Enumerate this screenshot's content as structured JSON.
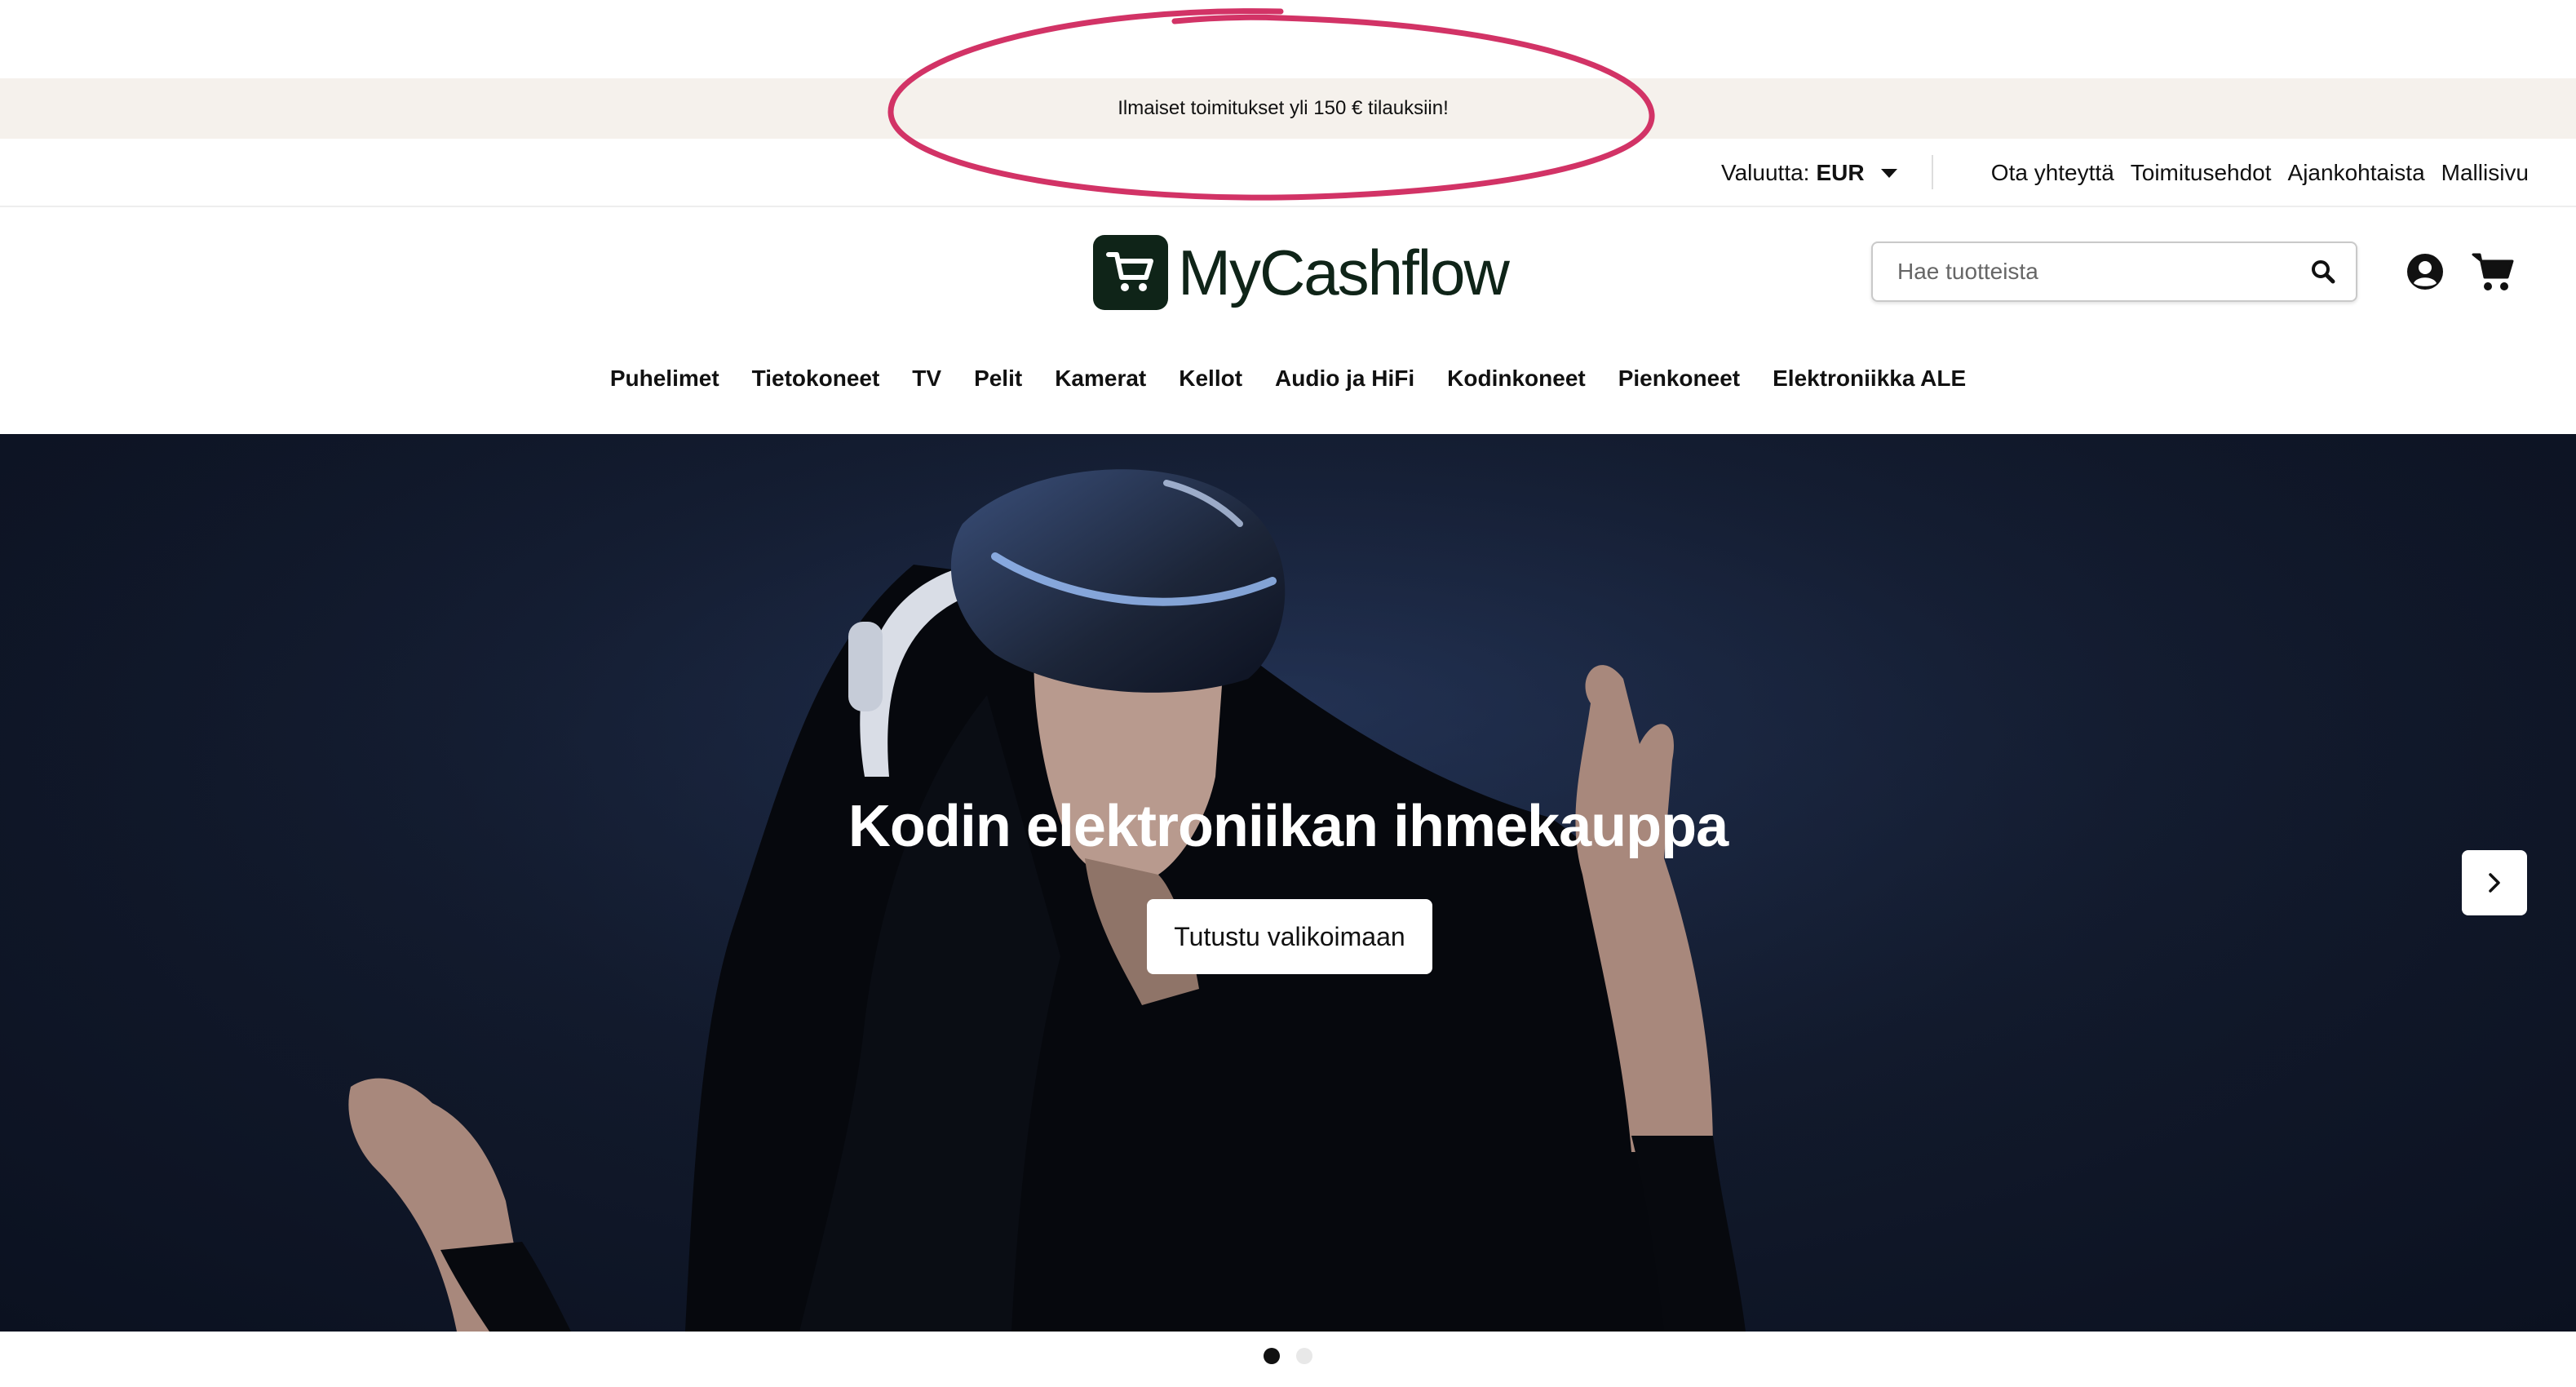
{
  "promo": {
    "text": "Ilmaiset toimitukset yli 150 € tilauksiin!"
  },
  "utility": {
    "currency_label": "Valuutta:",
    "currency_value": "EUR",
    "links": [
      "Ota yhteyttä",
      "Toimitusehdot",
      "Ajankohtaista",
      "Mallisivu"
    ]
  },
  "header": {
    "logo_text": "MyCashflow",
    "search_placeholder": "Hae tuotteista",
    "icons": [
      "search-icon",
      "account-icon",
      "cart-icon"
    ]
  },
  "nav": {
    "items": [
      "Puhelimet",
      "Tietokoneet",
      "TV",
      "Pelit",
      "Kamerat",
      "Kellot",
      "Audio ja HiFi",
      "Kodinkoneet",
      "Pienkoneet",
      "Elektroniikka ALE"
    ]
  },
  "hero": {
    "title": "Kodin elektroniikan ihmekauppa",
    "cta": "Tutustu valikoimaan",
    "slide_count": 2,
    "active_slide": 1
  },
  "colors": {
    "brand": "#0f2418",
    "promo_bg": "#f5f1ec",
    "annotation": "#d23366"
  }
}
